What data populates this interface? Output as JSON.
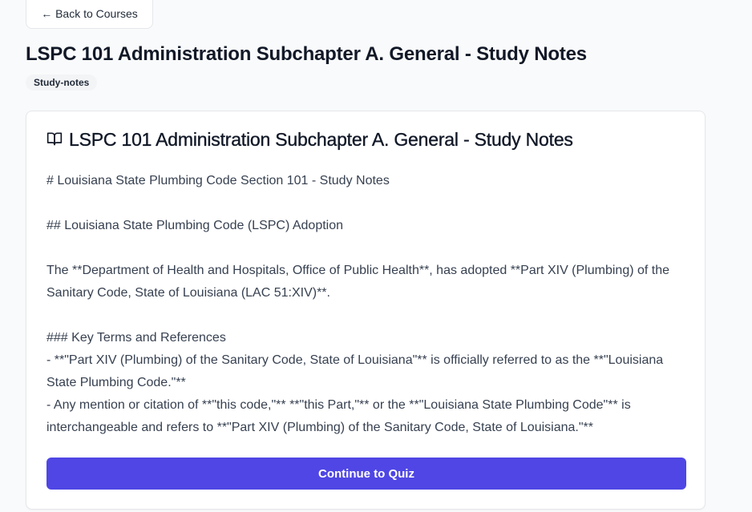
{
  "nav": {
    "back_label": "← Back to Courses"
  },
  "header": {
    "title": "LSPC 101 Administration Subchapter A. General - Study Notes",
    "badge": "Study-notes"
  },
  "card": {
    "icon": "book-open-icon",
    "title": "LSPC 101 Administration Subchapter A. General - Study Notes",
    "lines": [
      "# Louisiana State Plumbing Code Section 101 - Study Notes",
      "## Louisiana State Plumbing Code (LSPC) Adoption",
      "The **Department of Health and Hospitals, Office of Public Health**, has adopted **Part XIV (Plumbing) of the Sanitary Code, State of Louisiana (LAC 51:XIV)**.",
      "### Key Terms and References",
      "- **\"Part XIV (Plumbing) of the Sanitary Code, State of Louisiana\"** is officially referred to as the **\"Louisiana State Plumbing Code.\"**",
      "- Any mention or citation of **\"this code,\"** **\"this Part,\"** or the **\"Louisiana State Plumbing Code\"** is interchangeable and refers to **\"Part XIV (Plumbing) of the Sanitary Code, State of Louisiana.\"**"
    ],
    "cta_label": "Continue to Quiz"
  },
  "colors": {
    "accent": "#4f46e5",
    "background": "#f9fafb",
    "card": "#ffffff",
    "border": "#e5e7eb"
  }
}
